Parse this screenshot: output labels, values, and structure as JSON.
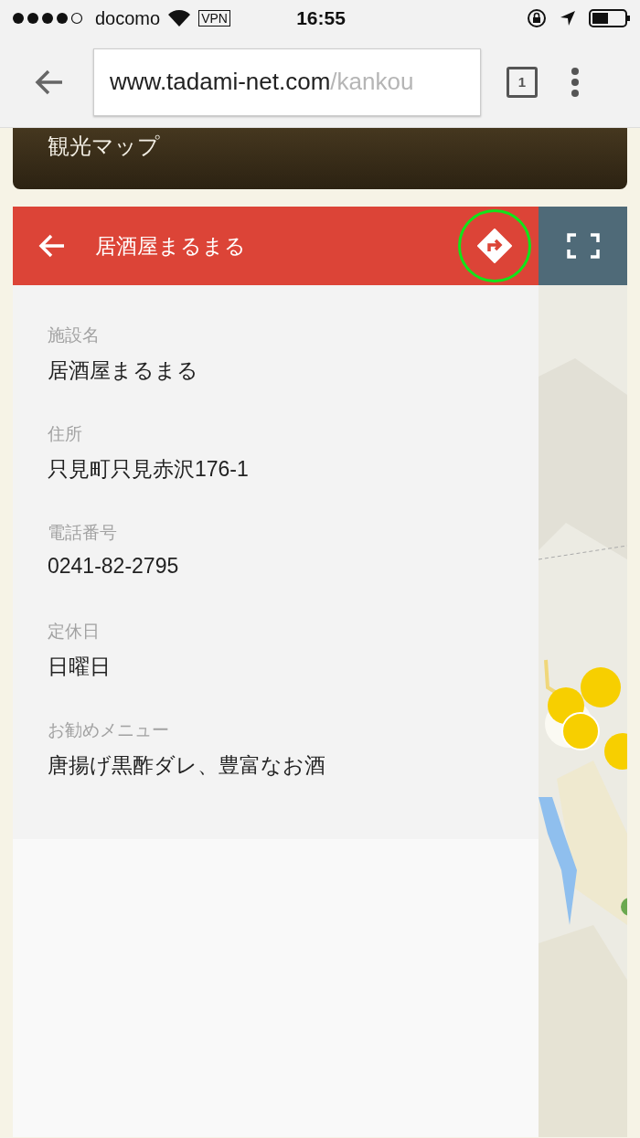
{
  "status_bar": {
    "carrier": "docomo",
    "vpn": "VPN",
    "time": "16:55"
  },
  "browser": {
    "url_host": "www.tadami-net.com",
    "url_path": "/kankou",
    "tab_count": "1"
  },
  "page_header": {
    "title": "観光マップ"
  },
  "panel": {
    "title": "居酒屋まるまる",
    "directions_highlighted": true
  },
  "fields": [
    {
      "label": "施設名",
      "value": "居酒屋まるまる"
    },
    {
      "label": "住所",
      "value": "只見町只見赤沢176-1"
    },
    {
      "label": "電話番号",
      "value": "0241-82-2795"
    },
    {
      "label": "定休日",
      "value": "日曜日"
    },
    {
      "label": "お勧めメニュー",
      "value": "唐揚げ黒酢ダレ、豊富なお酒"
    }
  ]
}
